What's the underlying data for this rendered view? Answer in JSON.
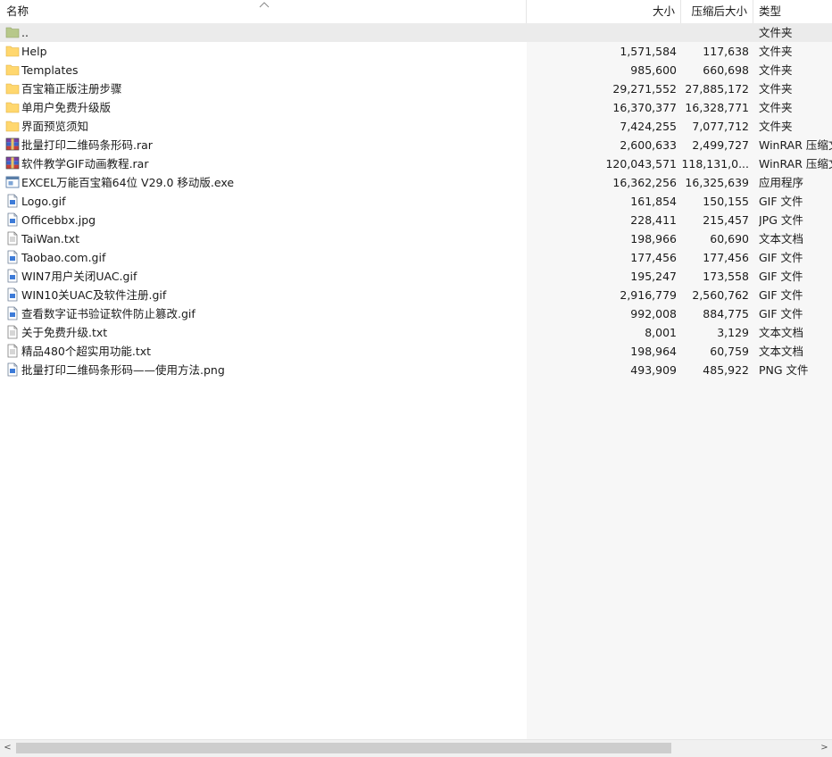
{
  "columns": {
    "name": "名称",
    "size": "大小",
    "compressed": "压缩后大小",
    "type": "类型"
  },
  "files": [
    {
      "icon": "parent-folder-icon",
      "name": "..",
      "size": "",
      "compressed": "",
      "type": "文件夹",
      "selected": true
    },
    {
      "icon": "folder-icon",
      "name": "Help",
      "size": "1,571,584",
      "compressed": "117,638",
      "type": "文件夹"
    },
    {
      "icon": "folder-icon",
      "name": "Templates",
      "size": "985,600",
      "compressed": "660,698",
      "type": "文件夹"
    },
    {
      "icon": "folder-icon",
      "name": "百宝箱正版注册步骤",
      "size": "29,271,552",
      "compressed": "27,885,172",
      "type": "文件夹"
    },
    {
      "icon": "folder-icon",
      "name": "单用户免费升级版",
      "size": "16,370,377",
      "compressed": "16,328,771",
      "type": "文件夹"
    },
    {
      "icon": "folder-icon",
      "name": "界面预览须知",
      "size": "7,424,255",
      "compressed": "7,077,712",
      "type": "文件夹"
    },
    {
      "icon": "rar-archive-icon",
      "name": "批量打印二维码条形码.rar",
      "size": "2,600,633",
      "compressed": "2,499,727",
      "type": "WinRAR 压缩文件"
    },
    {
      "icon": "rar-archive-icon",
      "name": "软件教学GIF动画教程.rar",
      "size": "120,043,571",
      "compressed": "118,131,0...",
      "type": "WinRAR 压缩文件"
    },
    {
      "icon": "exe-app-icon",
      "name": "EXCEL万能百宝箱64位 V29.0 移动版.exe",
      "size": "16,362,256",
      "compressed": "16,325,639",
      "type": "应用程序"
    },
    {
      "icon": "image-file-icon",
      "name": "Logo.gif",
      "size": "161,854",
      "compressed": "150,155",
      "type": "GIF 文件"
    },
    {
      "icon": "image-file-icon",
      "name": "Officebbx.jpg",
      "size": "228,411",
      "compressed": "215,457",
      "type": "JPG 文件"
    },
    {
      "icon": "text-file-icon",
      "name": "TaiWan.txt",
      "size": "198,966",
      "compressed": "60,690",
      "type": "文本文档"
    },
    {
      "icon": "image-file-icon",
      "name": "Taobao.com.gif",
      "size": "177,456",
      "compressed": "177,456",
      "type": "GIF 文件"
    },
    {
      "icon": "image-file-icon",
      "name": "WIN7用户关闭UAC.gif",
      "size": "195,247",
      "compressed": "173,558",
      "type": "GIF 文件"
    },
    {
      "icon": "image-file-icon",
      "name": "WIN10关UAC及软件注册.gif",
      "size": "2,916,779",
      "compressed": "2,560,762",
      "type": "GIF 文件"
    },
    {
      "icon": "image-file-icon",
      "name": "查看数字证书验证软件防止篡改.gif",
      "size": "992,008",
      "compressed": "884,775",
      "type": "GIF 文件"
    },
    {
      "icon": "text-file-icon",
      "name": "关于免费升级.txt",
      "size": "8,001",
      "compressed": "3,129",
      "type": "文本文档"
    },
    {
      "icon": "text-file-icon",
      "name": "精品480个超实用功能.txt",
      "size": "198,964",
      "compressed": "60,759",
      "type": "文本文档"
    },
    {
      "icon": "image-file-icon",
      "name": "批量打印二维码条形码——使用方法.png",
      "size": "493,909",
      "compressed": "485,922",
      "type": "PNG 文件"
    }
  ],
  "scrollbar": {
    "left_arrow": "<",
    "right_arrow": ">"
  },
  "colors": {
    "folder": "#ffd76e",
    "parent_folder": "#b7c88a",
    "selected_row": "#ebebeb",
    "shaded_columns": "#f7f7f7"
  }
}
